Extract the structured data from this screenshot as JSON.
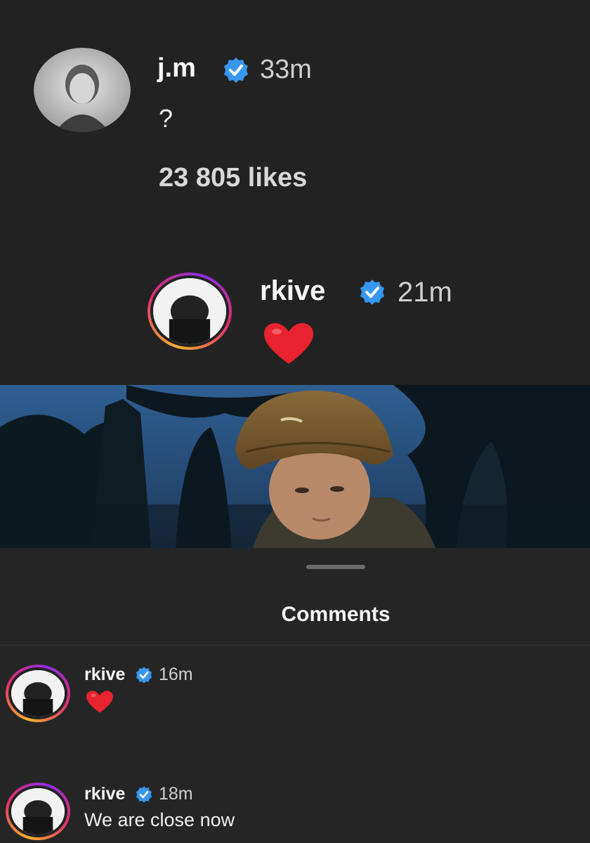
{
  "post": {
    "username": "j.m",
    "time": "33m",
    "caption": "?",
    "likes": "23 805 likes"
  },
  "reply": {
    "username": "rkive",
    "time": "21m",
    "content_icon": "red-heart-emoji"
  },
  "comments_sheet": {
    "title": "Comments",
    "comments": [
      {
        "username": "rkive",
        "time": "16m",
        "content_icon": "red-heart-emoji"
      },
      {
        "username": "rkive",
        "time": "18m",
        "text": "We are close now"
      }
    ]
  },
  "colors": {
    "verified_blue": "#3897f0",
    "heart_red": "#e8222f",
    "background": "#222222"
  }
}
